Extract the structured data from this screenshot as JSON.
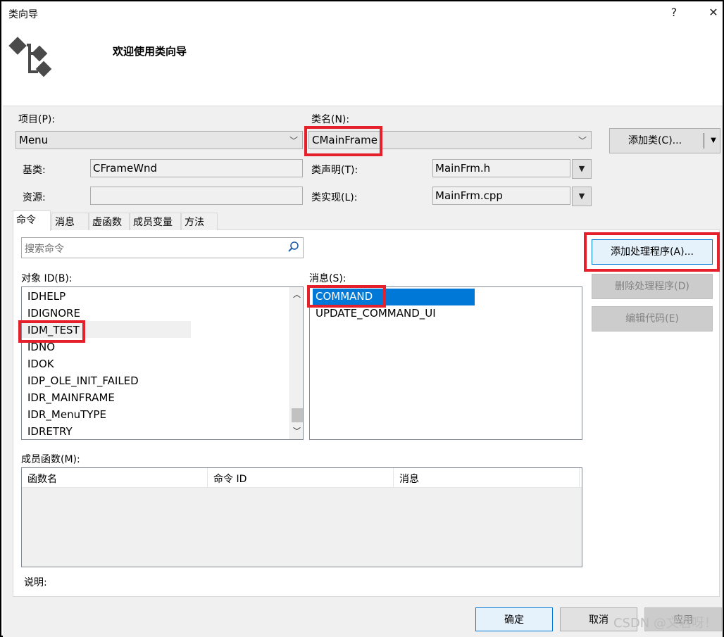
{
  "window": {
    "title": "类向导",
    "help_glyph": "?",
    "close_glyph": "✕",
    "header_title": "欢迎使用类向导"
  },
  "project": {
    "label": "项目(P):",
    "value": "Menu"
  },
  "class_name": {
    "label": "类名(N):",
    "value": "CMainFrame"
  },
  "add_class": {
    "label": "添加类(C)..."
  },
  "base_class": {
    "label": "基类:",
    "value": "CFrameWnd"
  },
  "resource": {
    "label": "资源:",
    "value": ""
  },
  "class_decl": {
    "label": "类声明(T):",
    "value": "MainFrm.h"
  },
  "class_impl": {
    "label": "类实现(L):",
    "value": "MainFrm.cpp"
  },
  "tabs": [
    {
      "label": "命令",
      "active": true
    },
    {
      "label": "消息",
      "active": false
    },
    {
      "label": "虚函数",
      "active": false
    },
    {
      "label": "成员变量",
      "active": false
    },
    {
      "label": "方法",
      "active": false
    }
  ],
  "search": {
    "placeholder": "搜索命令"
  },
  "object_ids": {
    "label": "对象 ID(B):",
    "items": [
      "IDHELP",
      "IDIGNORE",
      "IDM_TEST",
      "IDNO",
      "IDOK",
      "IDP_OLE_INIT_FAILED",
      "IDR_MAINFRAME",
      "IDR_MenuTYPE",
      "IDRETRY"
    ],
    "selected": "IDM_TEST"
  },
  "messages": {
    "label": "消息(S):",
    "items": [
      "COMMAND",
      "UPDATE_COMMAND_UI"
    ],
    "selected": "COMMAND"
  },
  "handlers": {
    "add": "添加处理程序(A)...",
    "delete": "删除处理程序(D)",
    "edit": "编辑代码(E)"
  },
  "member_functions": {
    "label": "成员函数(M):",
    "columns": [
      "函数名",
      "命令 ID",
      "消息"
    ]
  },
  "description": {
    "label": "说明:"
  },
  "footer": {
    "ok": "确定",
    "cancel": "取消",
    "apply": "应用",
    "watermark": "CSDN @文君呀！"
  },
  "colors": {
    "highlight_box": "#e6202a",
    "selection": "#0078d7"
  }
}
